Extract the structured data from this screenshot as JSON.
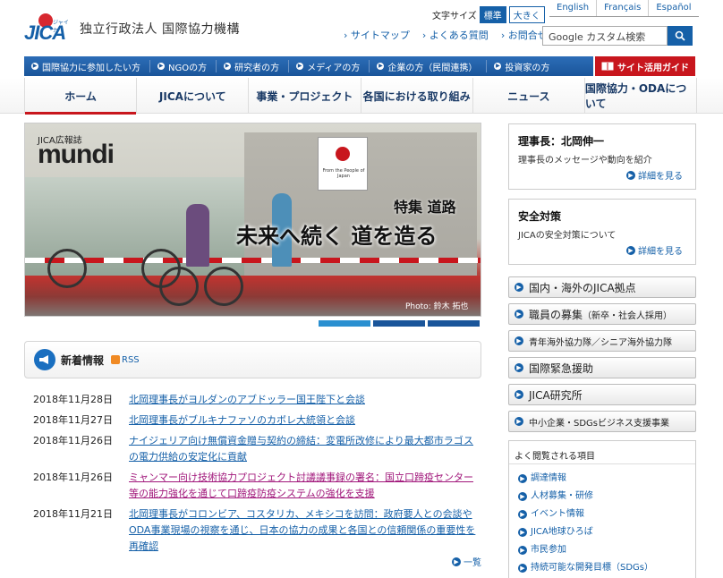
{
  "header": {
    "logo_text": "JICA",
    "logo_small": "ジャイカ",
    "org_name": "独立行政法人 国際協力機構",
    "font_size_label": "文字サイズ",
    "font_size_options": [
      "標準",
      "大きく"
    ],
    "languages": [
      "English",
      "Français",
      "Español"
    ],
    "util_links": [
      "サイトマップ",
      "よくある質問",
      "お問合せ"
    ],
    "search_placeholder": "Google カスタム検索"
  },
  "audience_bar": {
    "items": [
      "国際協力に参加したい方",
      "NGOの方",
      "研究者の方",
      "メディアの方",
      "企業の方（民間連携）",
      "投資家の方"
    ],
    "guide_label": "サイト活用ガイド"
  },
  "main_nav": {
    "items": [
      "ホーム",
      "JICAについて",
      "事業・プロジェクト",
      "各国における取り組み",
      "ニュース",
      "国際協力・ODAについて"
    ]
  },
  "hero": {
    "label": "JICA広報誌",
    "title": "mundi",
    "feature_label": "特集 道路",
    "feature_title": "未来へ続く 道を造る",
    "photo_credit": "Photo: 鈴木 拓也",
    "sign_caption": "From the People of Japan"
  },
  "news": {
    "title": "新着情報",
    "rss_label": "RSS",
    "more_label": "一覧",
    "items": [
      {
        "date": "2018年11月28日",
        "text": "北岡理事長がヨルダンのアブドッラー国王陛下と会談"
      },
      {
        "date": "2018年11月27日",
        "text": "北岡理事長がブルキナファソのカボレ大統領と会談"
      },
      {
        "date": "2018年11月26日",
        "text": "ナイジェリア向け無償資金贈与契約の締結：変電所改修により最大都市ラゴスの電力供給の安定化に貢献"
      },
      {
        "date": "2018年11月26日",
        "text": "ミャンマー向け技術協力プロジェクト討議議事録の署名：国立口蹄疫センター等の能力強化を通じて口蹄疫防疫システムの強化を支援"
      },
      {
        "date": "2018年11月21日",
        "text": "北岡理事長がコロンビア、コスタリカ、メキシコを訪問：政府要人との会談やODA事業現場の視察を通じ、日本の協力の成果と各国との信頼関係の重要性を再確認"
      }
    ]
  },
  "sidebar": {
    "president": {
      "title": "理事長：北岡伸一",
      "desc": "理事長のメッセージや動向を紹介",
      "more": "詳細を見る"
    },
    "safety": {
      "title": "安全対策",
      "desc": "JICAの安全対策について",
      "more": "詳細を見る"
    },
    "buttons": [
      "国内・海外のJICA拠点",
      "職員の募集",
      "（新卒・社会人採用）",
      "青年海外協力隊／シニア海外協力隊",
      "国際緊急援助",
      "JICA研究所",
      "中小企業・SDGsビジネス支援事業"
    ],
    "popular_title": "よく閲覧される項目",
    "popular_items": [
      "調達情報",
      "人材募集・研修",
      "イベント情報",
      "JICA地球ひろば",
      "市民参加",
      "持続可能な開発目標（SDGs）"
    ]
  },
  "colors": {
    "brand_blue": "#1560a8",
    "accent_red": "#c8161d"
  }
}
